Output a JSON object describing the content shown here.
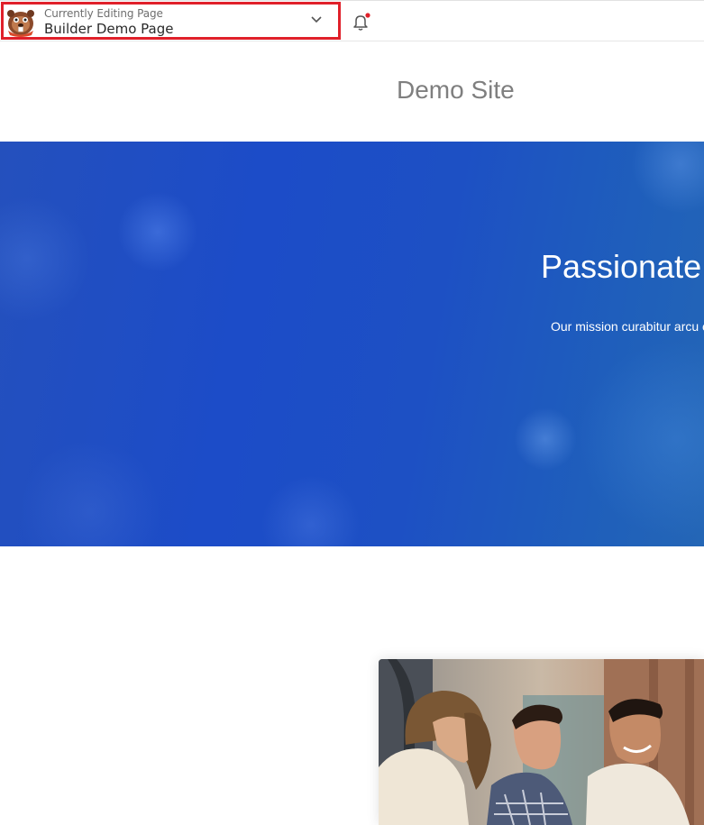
{
  "editor_bar": {
    "caption": "Currently Editing Page",
    "page_title": "Builder Demo Page",
    "logo_icon": "beaver-logo-icon",
    "dropdown_icon": "chevron-down-icon",
    "notification_icon": "bell-icon",
    "highlight_color": "#e0202a",
    "notification_dot_color": "#e0202a"
  },
  "site": {
    "title": "Demo Site"
  },
  "hero": {
    "heading": "Passionate",
    "text": "Our mission curabitur arcu e",
    "background_color": "#1c4cc8"
  },
  "feature": {
    "image": "team-collaboration-photo"
  }
}
